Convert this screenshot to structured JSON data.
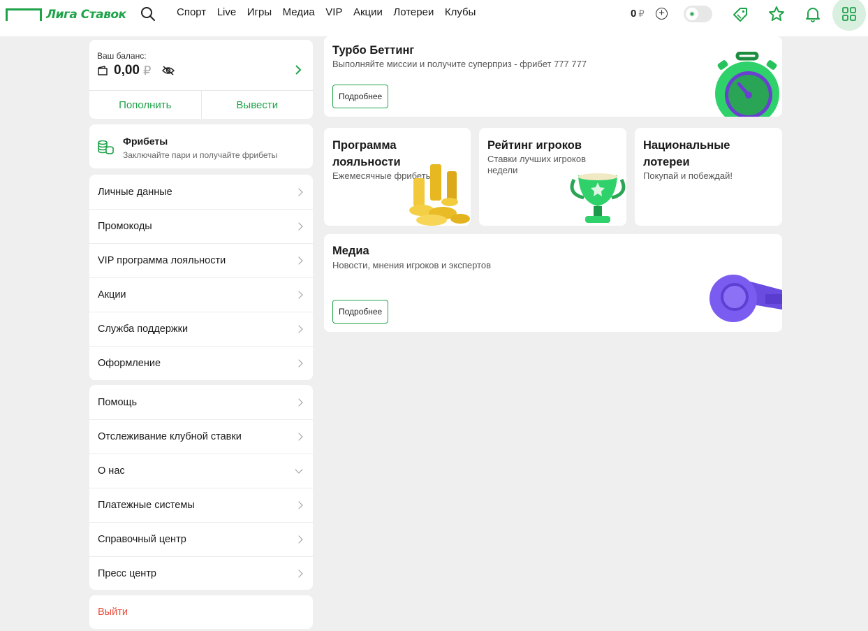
{
  "header": {
    "logo_text": "Лига Ставок",
    "nav": [
      "Спорт",
      "Live",
      "Игры",
      "Медиа",
      "VIP",
      "Акции",
      "Лотереи",
      "Клубы"
    ],
    "balance": "0",
    "currency": "₽"
  },
  "balance_card": {
    "label": "Ваш баланс:",
    "value": "0,00",
    "currency": "₽",
    "deposit": "Пополнить",
    "withdraw": "Вывести"
  },
  "freebets": {
    "title": "Фрибеты",
    "subtitle": "Заключайте пари и получайте фрибеты"
  },
  "menu1": [
    "Личные данные",
    "Промокоды",
    "VIP программа лояльности",
    "Акции",
    "Служба поддержки",
    "Оформление"
  ],
  "menu2": [
    "Помощь",
    "Отслеживание клубной ставки",
    "О нас",
    "Платежные системы",
    "Справочный центр",
    "Пресс центр"
  ],
  "logout": "Выйти",
  "promos": {
    "turbo": {
      "title": "Турбо Беттинг",
      "subtitle": "Выполняйте миссии и получите суперприз - фрибет 777 777",
      "button": "Подробнее"
    },
    "loyalty": {
      "title_1": "Программа",
      "title_2": "лояльности",
      "subtitle": "Ежемесячные фрибеты"
    },
    "rating": {
      "title": "Рейтинг игроков",
      "subtitle_1": "Ставки лучших игроков",
      "subtitle_2": "недели"
    },
    "lottery": {
      "title_1": "Национальные",
      "title_2": "лотереи",
      "subtitle": "Покупай и побеждай!"
    },
    "media": {
      "title": "Медиа",
      "subtitle": "Новости, мнения игроков и экспертов",
      "button": "Подробнее"
    }
  },
  "colors": {
    "brand": "#1fa34a",
    "logout": "#e84c3d",
    "background": "#efefef"
  }
}
